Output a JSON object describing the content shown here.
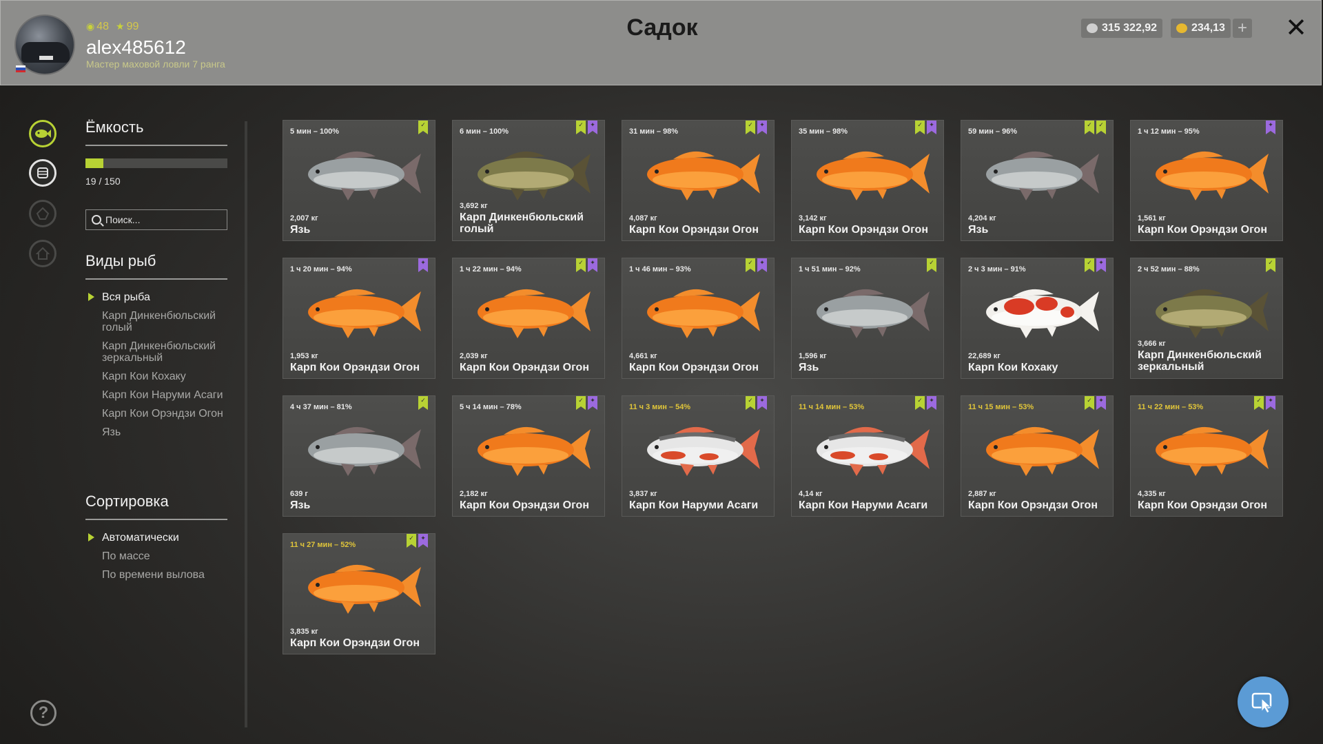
{
  "header": {
    "title": "Садок",
    "username": "alex485612",
    "rank": "Мастер маховой ловли 7 ранга",
    "level": "48",
    "stars": "99",
    "silver": "315 322,92",
    "gold": "234,13",
    "plus_icon": "plus-icon",
    "close_icon": "close-icon"
  },
  "nav": {
    "icons": [
      "fish-icon",
      "keepnet-icon",
      "tackle-icon",
      "home-icon"
    ],
    "help": "?"
  },
  "panel": {
    "capacity_title": "Ёмкость",
    "capacity_text": "19 / 150",
    "capacity_fill_fraction": 0.127,
    "search_placeholder": "Поиск...",
    "species_title": "Виды рыб",
    "species": [
      "Вся рыба",
      "Карп Динкенбюльский голый",
      "Карп Динкенбюльский зеркальный",
      "Карп Кои Кохаку",
      "Карп Кои Наруми Асаги",
      "Карп Кои Орэндзи Огон",
      "Язь"
    ],
    "species_selected": 0,
    "sort_title": "Сортировка",
    "sort": [
      "Автоматически",
      "По массе",
      "По времени вылова"
    ],
    "sort_selected": 0
  },
  "colors": {
    "accent_green": "#b8d234",
    "badge_purple": "#9c6adf",
    "time_yellow": "#e0c53a",
    "header_bg": "#8d8d8b",
    "fab_blue": "#5b9bd5"
  },
  "fish": [
    {
      "time": "5 мин – 100%",
      "weight": "2,007 кг",
      "name": "Язь",
      "kind": "ide",
      "badges": [
        "green"
      ],
      "time_yellow": false
    },
    {
      "time": "6 мин – 100%",
      "weight": "3,692 кг",
      "name": "Карп Динкенбюльский голый",
      "kind": "carp",
      "badges": [
        "green",
        "purple"
      ],
      "time_yellow": false
    },
    {
      "time": "31 мин – 98%",
      "weight": "4,087 кг",
      "name": "Карп Кои Орэндзи Огон",
      "kind": "orange",
      "badges": [
        "green",
        "purple"
      ],
      "time_yellow": false
    },
    {
      "time": "35 мин – 98%",
      "weight": "3,142 кг",
      "name": "Карп Кои Орэндзи Огон",
      "kind": "orange",
      "badges": [
        "green",
        "purple"
      ],
      "time_yellow": false
    },
    {
      "time": "59 мин – 96%",
      "weight": "4,204 кг",
      "name": "Язь",
      "kind": "ide",
      "badges": [
        "green",
        "green"
      ],
      "time_yellow": false
    },
    {
      "time": "1 ч 12 мин – 95%",
      "weight": "1,561 кг",
      "name": "Карп Кои Орэндзи Огон",
      "kind": "orange",
      "badges": [
        "purple"
      ],
      "time_yellow": false
    },
    {
      "time": "1 ч 20 мин – 94%",
      "weight": "1,953 кг",
      "name": "Карп Кои Орэндзи Огон",
      "kind": "orange",
      "badges": [
        "purple"
      ],
      "time_yellow": false
    },
    {
      "time": "1 ч 22 мин – 94%",
      "weight": "2,039 кг",
      "name": "Карп Кои Орэндзи Огон",
      "kind": "orange",
      "badges": [
        "green",
        "purple"
      ],
      "time_yellow": false
    },
    {
      "time": "1 ч 46 мин – 93%",
      "weight": "4,661 кг",
      "name": "Карп Кои Орэндзи Огон",
      "kind": "orange",
      "badges": [
        "green",
        "purple"
      ],
      "time_yellow": false
    },
    {
      "time": "1 ч 51 мин – 92%",
      "weight": "1,596 кг",
      "name": "Язь",
      "kind": "ide",
      "badges": [
        "green"
      ],
      "time_yellow": false
    },
    {
      "time": "2 ч 3 мин – 91%",
      "weight": "22,689 кг",
      "name": "Карп Кои Кохаку",
      "kind": "kohaku",
      "badges": [
        "green",
        "purple"
      ],
      "time_yellow": false
    },
    {
      "time": "2 ч 52 мин – 88%",
      "weight": "3,666 кг",
      "name": "Карп Динкенбюльский зеркальный",
      "kind": "carp",
      "badges": [
        "green"
      ],
      "time_yellow": false
    },
    {
      "time": "4 ч 37 мин – 81%",
      "weight": "639 г",
      "name": "Язь",
      "kind": "ide",
      "badges": [
        "green"
      ],
      "time_yellow": false
    },
    {
      "time": "5 ч 14 мин – 78%",
      "weight": "2,182 кг",
      "name": "Карп Кои Орэндзи Огон",
      "kind": "orange",
      "badges": [
        "green",
        "purple"
      ],
      "time_yellow": false
    },
    {
      "time": "11 ч 3 мин – 54%",
      "weight": "3,837 кг",
      "name": "Карп Кои Наруми Асаги",
      "kind": "asagi",
      "badges": [
        "green",
        "purple"
      ],
      "time_yellow": true
    },
    {
      "time": "11 ч 14 мин – 53%",
      "weight": "4,14 кг",
      "name": "Карп Кои Наруми Асаги",
      "kind": "asagi",
      "badges": [
        "green",
        "purple"
      ],
      "time_yellow": true
    },
    {
      "time": "11 ч 15 мин – 53%",
      "weight": "2,887 кг",
      "name": "Карп Кои Орэндзи Огон",
      "kind": "orange",
      "badges": [
        "green",
        "purple"
      ],
      "time_yellow": true
    },
    {
      "time": "11 ч 22 мин – 53%",
      "weight": "4,335 кг",
      "name": "Карп Кои Орэндзи Огон",
      "kind": "orange",
      "badges": [
        "green",
        "purple"
      ],
      "time_yellow": true
    },
    {
      "time": "11 ч 27 мин – 52%",
      "weight": "3,835 кг",
      "name": "Карп Кои Орэндзи Огон",
      "kind": "orange",
      "badges": [
        "green",
        "purple"
      ],
      "time_yellow": true
    }
  ],
  "fab_icon": "cursor-icon"
}
